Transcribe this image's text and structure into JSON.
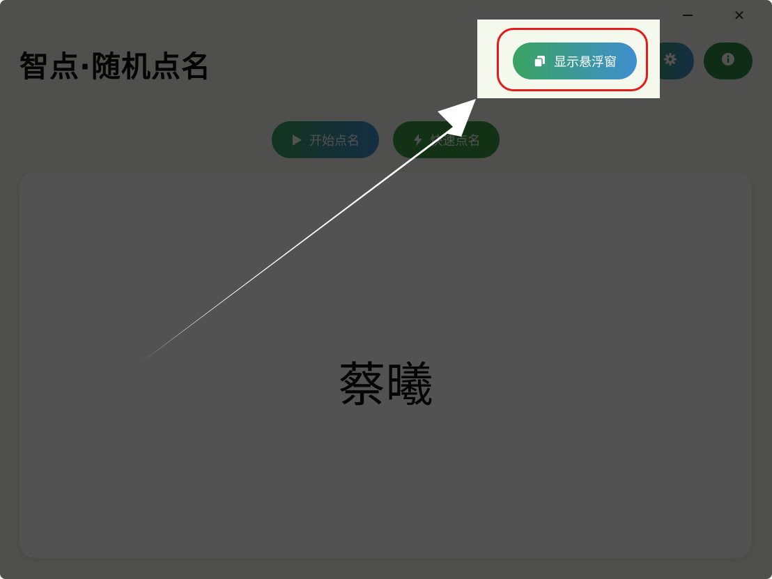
{
  "window": {
    "minimize_label": "—",
    "close_label": "✕"
  },
  "app": {
    "title": "智点·随机点名"
  },
  "header_buttons": {
    "floating_window_label": "显示悬浮窗",
    "settings_icon": "gear-icon",
    "about_icon": "info-icon"
  },
  "actions": {
    "start_label": "开始点名",
    "quick_label": "快速点名"
  },
  "result": {
    "name": "蔡曦"
  },
  "colors": {
    "accent_green": "#3aa35f",
    "accent_blue": "#3e8fd0",
    "highlight_red": "#e31b1b"
  }
}
